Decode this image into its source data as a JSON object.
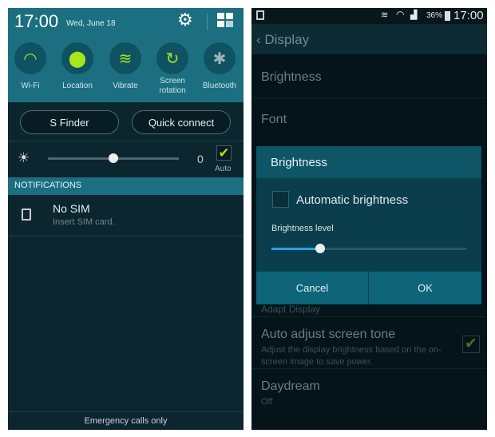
{
  "left": {
    "time": "17:00",
    "date": "Wed, June 18",
    "quick_settings": [
      {
        "label": "Wi-Fi",
        "icon": "wifi-icon",
        "glyph": "◠"
      },
      {
        "label": "Location",
        "icon": "location-icon",
        "glyph": "⬤"
      },
      {
        "label": "Vibrate",
        "icon": "vibrate-icon",
        "glyph": "≋"
      },
      {
        "label": "Screen\nrotation",
        "icon": "screen-rotation-icon",
        "glyph": "↻"
      },
      {
        "label": "Bluetooth",
        "icon": "bluetooth-icon",
        "glyph": "✱"
      }
    ],
    "s_finder": "S Finder",
    "quick_connect": "Quick connect",
    "brightness_value": "0",
    "brightness_level_percent": 50,
    "auto_label": "Auto",
    "auto_checked": true,
    "notifications_header": "NOTIFICATIONS",
    "notification": {
      "title": "No SIM",
      "text": "Insert SIM card."
    },
    "footer": "Emergency calls only",
    "accent": "#a8e61d"
  },
  "right": {
    "status": {
      "battery": "36%",
      "time": "17:00"
    },
    "title": "Display",
    "items": {
      "brightness": "Brightness",
      "font": "Font",
      "adapt": "Adapt Display",
      "auto_tone": "Auto adjust screen tone",
      "auto_tone_sub": "Adjust the display brightness based on the on-screen image to save power.",
      "auto_tone_checked": true,
      "daydream": "Daydream",
      "daydream_sub": "Off"
    },
    "dialog": {
      "title": "Brightness",
      "auto_label": "Automatic brightness",
      "auto_checked": false,
      "level_label": "Brightness level",
      "level_percent": 25,
      "cancel": "Cancel",
      "ok": "OK"
    }
  }
}
